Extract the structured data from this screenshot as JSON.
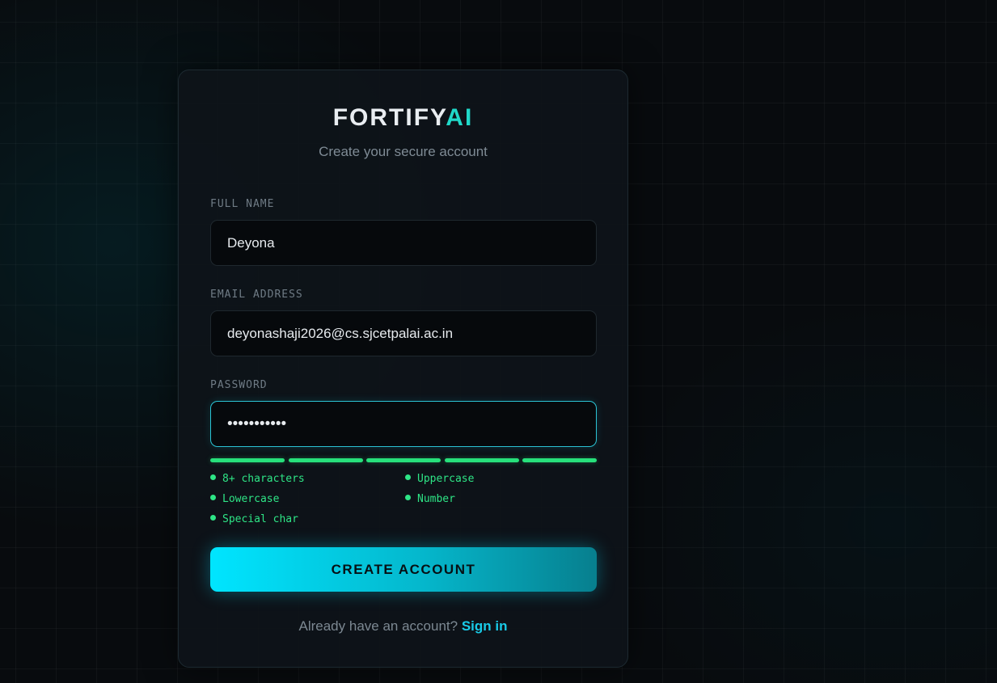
{
  "brand": {
    "name_main": "FORTIFY",
    "name_accent": "AI",
    "accent_color": "#20d8c8"
  },
  "subtitle": "Create your secure account",
  "form": {
    "full_name": {
      "label": "FULL NAME",
      "value": "Deyona"
    },
    "email": {
      "label": "EMAIL ADDRESS",
      "value": "deyonashaji2026@cs.sjcetpalai.ac.in"
    },
    "password": {
      "label": "PASSWORD",
      "masked_value": "•••••••••••",
      "focused": true
    }
  },
  "password_strength": {
    "segments_total": 5,
    "segments_filled": 5,
    "color": "#27e07b"
  },
  "requirements": [
    {
      "label": "8+ characters",
      "met": true
    },
    {
      "label": "Uppercase",
      "met": true
    },
    {
      "label": "Lowercase",
      "met": true
    },
    {
      "label": "Number",
      "met": true
    },
    {
      "label": "Special char",
      "met": true
    }
  ],
  "submit_button": {
    "label": "CREATE ACCOUNT"
  },
  "footer": {
    "prompt": "Already have an account?",
    "link_label": "Sign in"
  }
}
